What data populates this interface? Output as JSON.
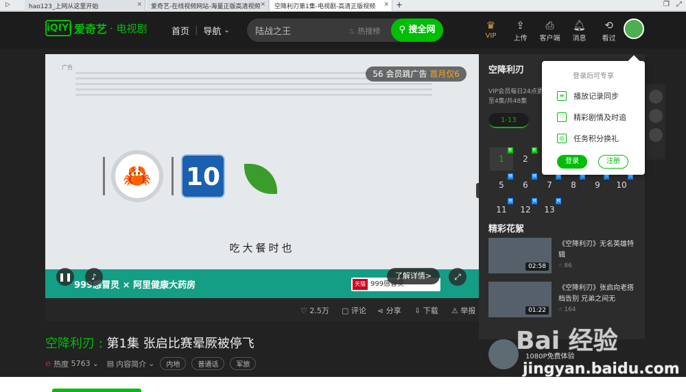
{
  "browser": {
    "tabs": [
      {
        "label": "hao123_上网从这里开始"
      },
      {
        "label": "爱奇艺-在线视频网站-海量正版高清视频"
      },
      {
        "label": "空降利刃第1集-电视剧-高清正版视频"
      }
    ]
  },
  "header": {
    "logo_mark": "iQIYI",
    "logo_text": "爱奇艺",
    "channel": "· 电视剧",
    "nav_home": "首页",
    "nav_guide": "导航",
    "search_value": "陆战之王",
    "hot_search": "热搜榜",
    "search_button": "搜全网",
    "icons": [
      {
        "label": "VIP",
        "icon": "crown-icon"
      },
      {
        "label": "上传",
        "icon": "upload-icon"
      },
      {
        "label": "客户端",
        "icon": "client-icon"
      },
      {
        "label": "消息",
        "icon": "bell-icon"
      },
      {
        "label": "看过",
        "icon": "history-icon"
      }
    ]
  },
  "player": {
    "ad_tag": "广告",
    "ad_seconds": "56",
    "ad_count_label": "会员跳广告",
    "ad_trial": "首月仅6",
    "number_badge": "10",
    "slogan": "吃大餐时也",
    "band_text": "999感冒灵 × 阿里健康大药房",
    "tmall": "天猫",
    "shop_text": "999感冒灵",
    "detail_button": "了解详情>"
  },
  "actions": {
    "likes": "2.5万",
    "comment": "评论",
    "share": "分享",
    "download": "下载",
    "report": "举报"
  },
  "video": {
    "show": "空降利刃",
    "episode_title": "第1集 张启比赛晕厥被停飞",
    "heat_label": "热度",
    "heat_value": "5763",
    "intro": "内容简介",
    "tags": [
      "内地",
      "普通话",
      "军旅"
    ]
  },
  "sidebar": {
    "title": "空降利刃",
    "info": "VIP会员每日24点更新至4集/共48集",
    "range": "1-13",
    "episodes": [
      {
        "num": "1",
        "badge": "新"
      },
      {
        "num": "2",
        "badge": "新"
      },
      {
        "num": "5",
        "badge": "预"
      },
      {
        "num": "6",
        "badge": "预"
      },
      {
        "num": "7",
        "badge": "预"
      },
      {
        "num": "8",
        "badge": "预"
      },
      {
        "num": "9",
        "badge": "预"
      },
      {
        "num": "10",
        "badge": "预"
      },
      {
        "num": "11",
        "badge": "预"
      },
      {
        "num": "12",
        "badge": "预"
      },
      {
        "num": "13",
        "badge": "预"
      }
    ],
    "clips_title": "精彩花絮",
    "clips": [
      {
        "title": "《空降利刃》无名英雄特辑",
        "duration": "02:58",
        "views": "86"
      },
      {
        "title": "《空降利刃》张启向老搭档告别 兄弟之间无",
        "duration": "01:22",
        "views": "164"
      }
    ],
    "promo_text": "1080P免费体验"
  },
  "login_popup": {
    "title": "登录后可专享",
    "items": [
      {
        "label": "播放记录同步"
      },
      {
        "label": "精彩剧情及时追"
      },
      {
        "label": "任务积分换礼"
      }
    ],
    "login": "登录",
    "register": "注册"
  },
  "watermark": {
    "text": "Bai 经验",
    "url": "jingyan.baidu.com"
  },
  "colors": {
    "brand": "#00be06",
    "background": "#222222",
    "ad_band": "#149e85"
  }
}
